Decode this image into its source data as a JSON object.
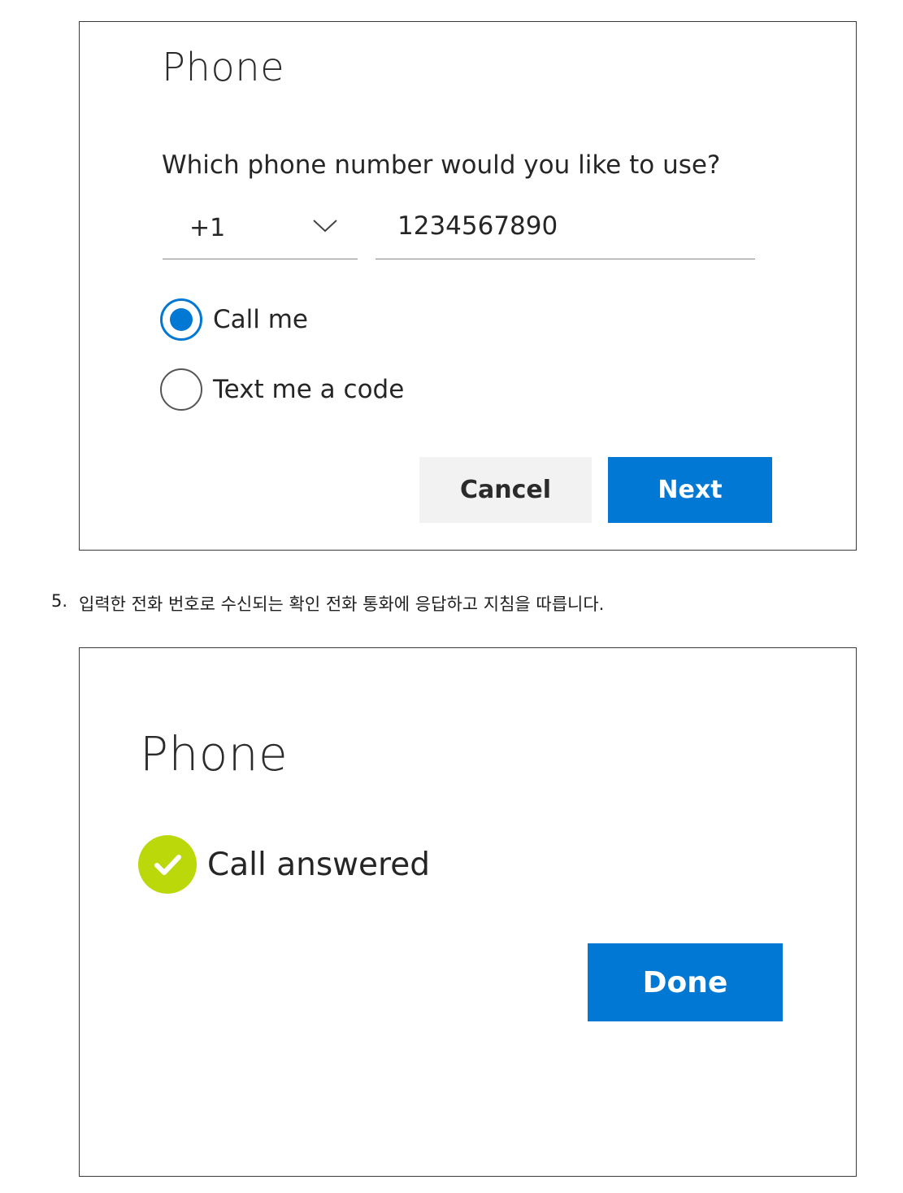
{
  "dialog_1": {
    "title": "Phone",
    "question": "Which phone number would you like to use?",
    "country_code": "+1",
    "phone_number": "1234567890",
    "options": [
      {
        "label": "Call me",
        "checked": true
      },
      {
        "label": "Text me a code",
        "checked": false
      }
    ],
    "cancel_label": "Cancel",
    "next_label": "Next"
  },
  "instruction": {
    "number": "5.",
    "text": "입력한 전화 번호로 수신되는 확인 전화 통화에 응답하고 지침을 따릅니다."
  },
  "dialog_2": {
    "title": "Phone",
    "status": "Call answered",
    "done_label": "Done"
  },
  "colors": {
    "accent_blue": "#0078d4",
    "success_green": "#bad80a",
    "cancel_bg": "#f2f2f2",
    "border": "#3a3a3a"
  },
  "icons": {
    "chevron": "chevron-down-icon",
    "check": "checkmark-circle-icon"
  }
}
